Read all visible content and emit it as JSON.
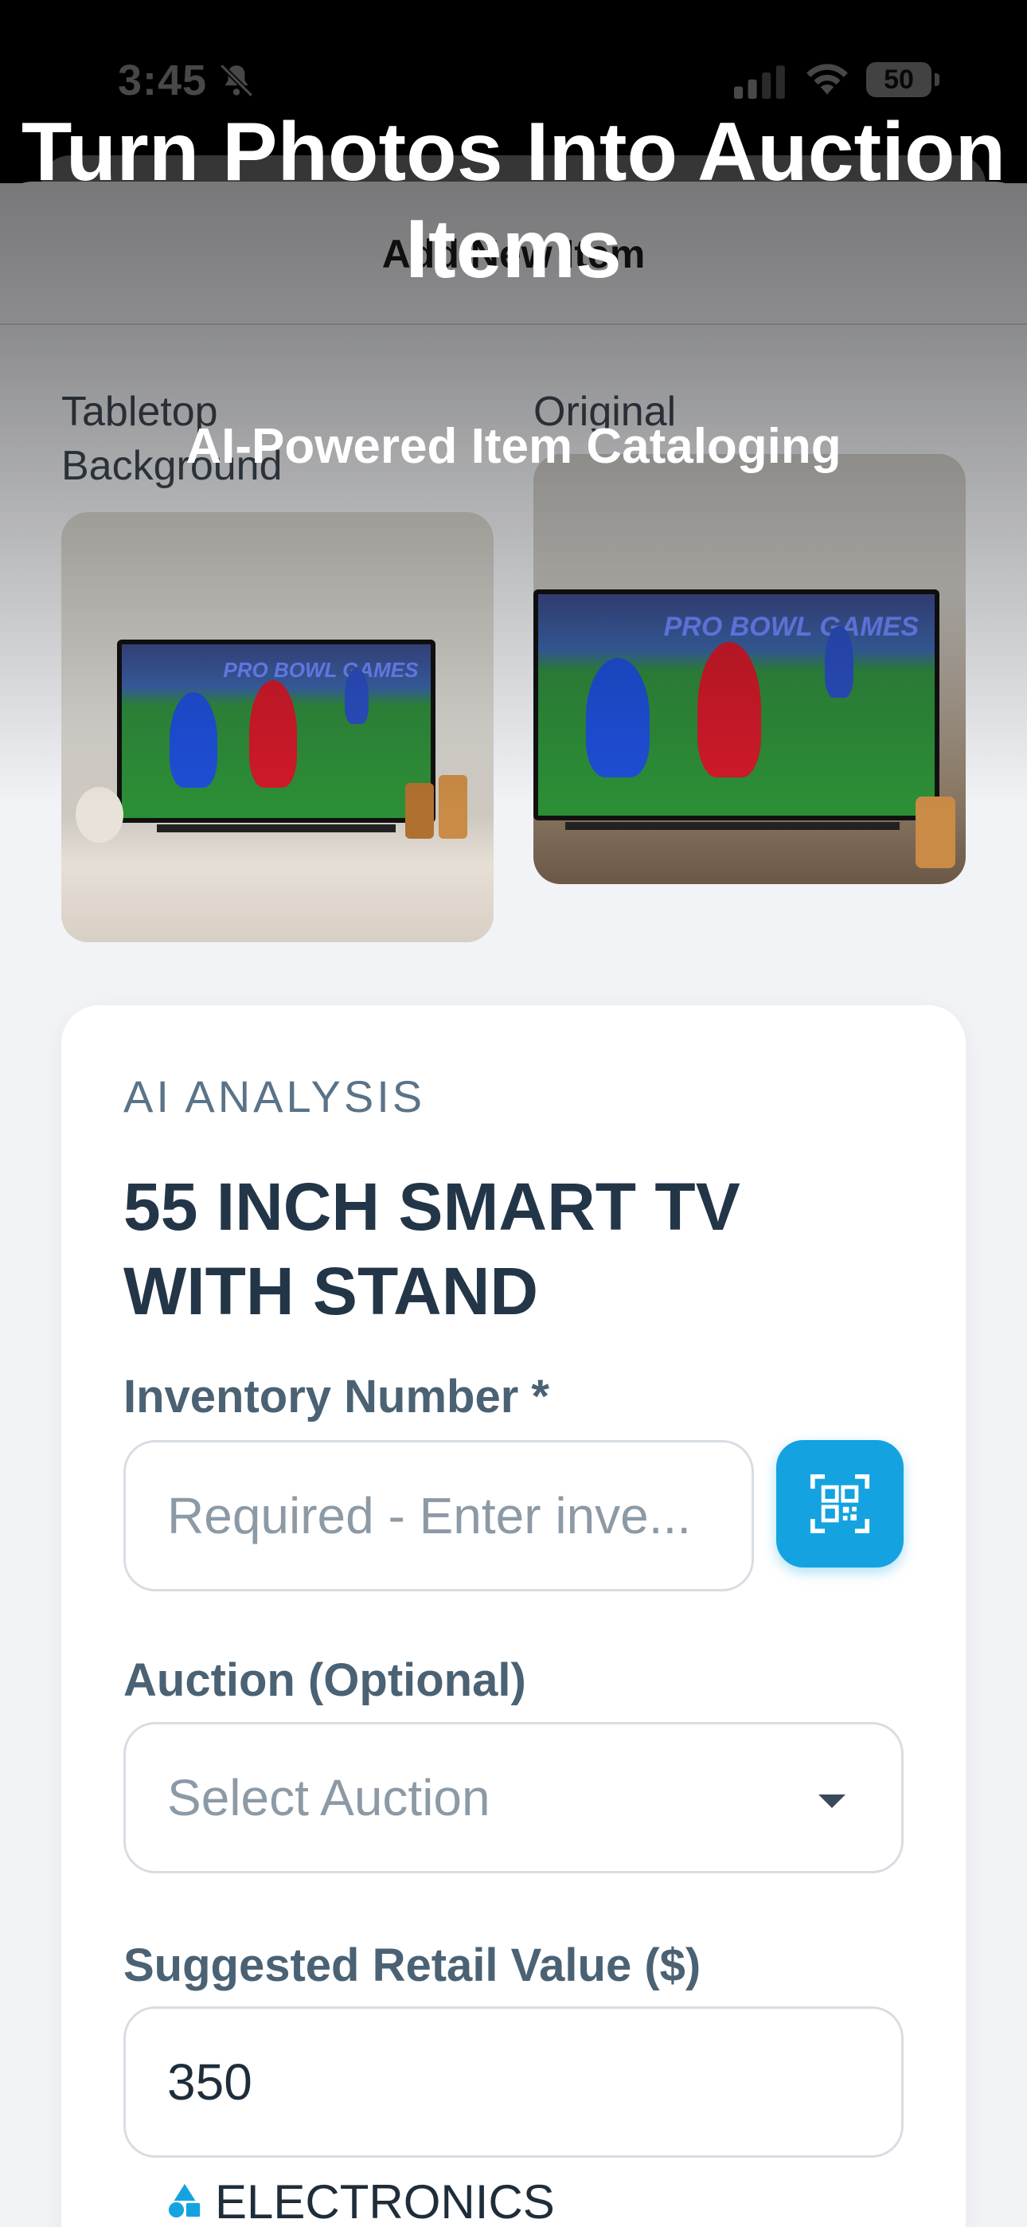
{
  "status_bar": {
    "time": "3:45",
    "battery": "50",
    "icons": [
      "bell-slash-icon",
      "signal-icon",
      "wifi-icon",
      "battery-icon"
    ]
  },
  "sheet": {
    "title": "Add New Item"
  },
  "hero": {
    "title": "Turn Photos Into Auction Items",
    "subtitle": "AI-Powered Item Cataloging"
  },
  "images": {
    "tabletop_label": "Tabletop Background",
    "original_label": "Original",
    "tv_banner": "PRO BOWL GAMES"
  },
  "analysis": {
    "eyebrow": "AI ANALYSIS",
    "item_title": "55 INCH SMART TV WITH STAND",
    "inventory_label": "Inventory Number *",
    "inventory_placeholder": "Required - Enter inve...",
    "auction_label": "Auction (Optional)",
    "auction_placeholder": "Select Auction",
    "retail_label": "Suggested Retail Value ($)",
    "retail_value": "350",
    "category": "ELECTRONICS"
  },
  "colors": {
    "accent": "#14a3e0",
    "heading": "#233648",
    "label": "#4a6274"
  }
}
